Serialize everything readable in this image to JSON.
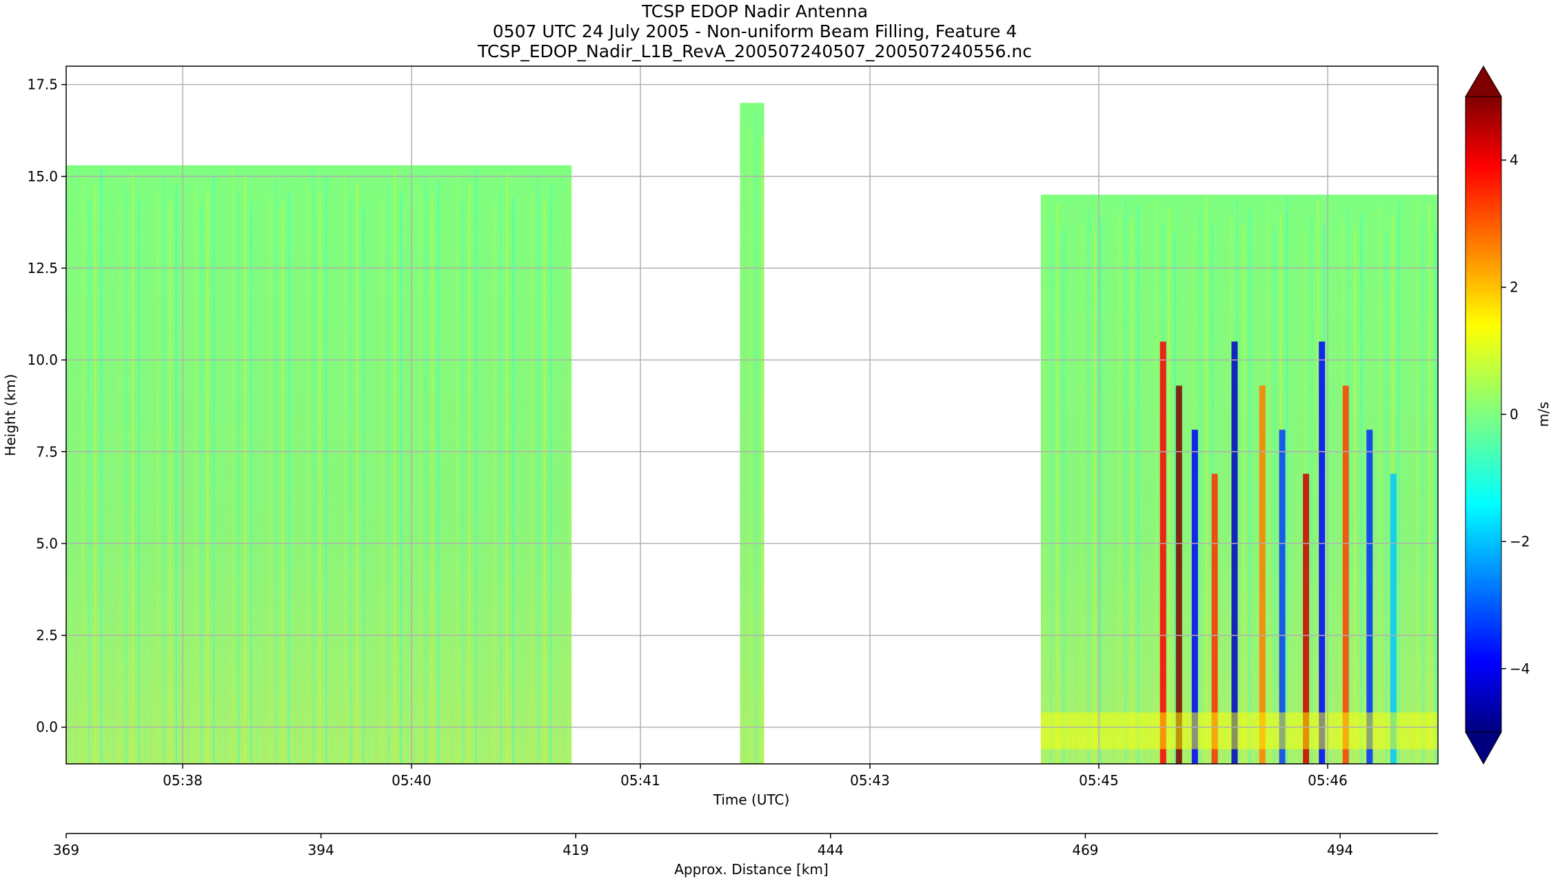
{
  "figure": {
    "title_lines": [
      "TCSP EDOP Nadir Antenna",
      "0507 UTC 24 July 2005 - Non-uniform Beam Filling, Feature 4",
      "TCSP_EDOP_Nadir_L1B_RevA_200507240507_200507240556.nc"
    ]
  },
  "chart_data": {
    "type": "heatmap",
    "title": "TCSP EDOP Nadir Antenna",
    "xlabel": "Time (UTC)",
    "ylabel": "Height (km)",
    "x_ticks": [
      "05:38",
      "05:40",
      "05:41",
      "05:43",
      "05:45",
      "05:46"
    ],
    "y_ticks": [
      "0.0",
      "2.5",
      "5.0",
      "7.5",
      "10.0",
      "12.5",
      "15.0",
      "17.5"
    ],
    "y_tick_values": [
      0,
      2.5,
      5,
      7.5,
      10,
      12.5,
      15,
      17.5
    ],
    "ylim": [
      -1,
      18
    ],
    "grid": true,
    "colorbar": {
      "label": "m/s",
      "ticks": [
        "−4",
        "−2",
        "0",
        "2",
        "4"
      ],
      "tick_values": [
        -4,
        -2,
        0,
        2,
        4
      ],
      "range": [
        -5,
        5
      ],
      "extend": "both",
      "colormap": "jet",
      "colors": [
        "#00007f",
        "#0000ff",
        "#007fff",
        "#00ffff",
        "#7fff7f",
        "#ffff00",
        "#ff7f00",
        "#ff0000",
        "#7f0000"
      ]
    },
    "secondary_xaxis": {
      "label": "Approx. Distance [km]",
      "ticks": [
        "369",
        "394",
        "419",
        "444",
        "469",
        "494"
      ],
      "tick_values": [
        369,
        394,
        419,
        444,
        469,
        494
      ]
    },
    "data_segments": [
      {
        "time_start": "05:37:00",
        "time_end": "05:40:30",
        "approx_top_km": 15.3,
        "description_values": "mostly -1 to 1 m/s, bands of 1 to 3 m/s below 5 km"
      },
      {
        "time_start": "05:41:40",
        "time_end": "05:41:50",
        "approx_top_km": 17.0,
        "description_values": "mostly -1 to 1 m/s"
      },
      {
        "time_start": "05:43:45",
        "time_end": "05:46:30",
        "approx_top_km": 14.5,
        "description_values": "strong updrafts/downdrafts -5 to 5 m/s"
      }
    ]
  }
}
